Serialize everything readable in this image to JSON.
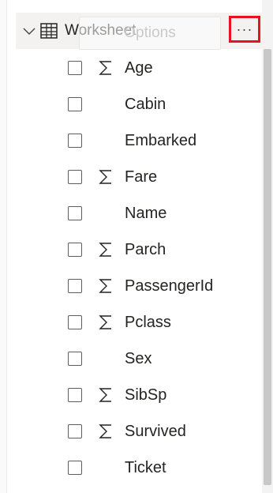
{
  "table": {
    "name": "Worksheet",
    "more_button_label": "···",
    "ghost_tooltip": "Options"
  },
  "fields": [
    {
      "label": "Age",
      "sigma": true
    },
    {
      "label": "Cabin",
      "sigma": false
    },
    {
      "label": "Embarked",
      "sigma": false
    },
    {
      "label": "Fare",
      "sigma": true
    },
    {
      "label": "Name",
      "sigma": false
    },
    {
      "label": "Parch",
      "sigma": true
    },
    {
      "label": "PassengerId",
      "sigma": true
    },
    {
      "label": "Pclass",
      "sigma": true
    },
    {
      "label": "Sex",
      "sigma": false
    },
    {
      "label": "SibSp",
      "sigma": true
    },
    {
      "label": "Survived",
      "sigma": true
    },
    {
      "label": "Ticket",
      "sigma": false
    }
  ],
  "colors": {
    "highlight_border": "#e81123",
    "header_background": "#f3f2f1",
    "text": "#252423"
  },
  "icons": {
    "expand": "chevron-down-icon",
    "table": "table-icon",
    "sum": "sigma-icon",
    "more": "more-options-icon"
  }
}
